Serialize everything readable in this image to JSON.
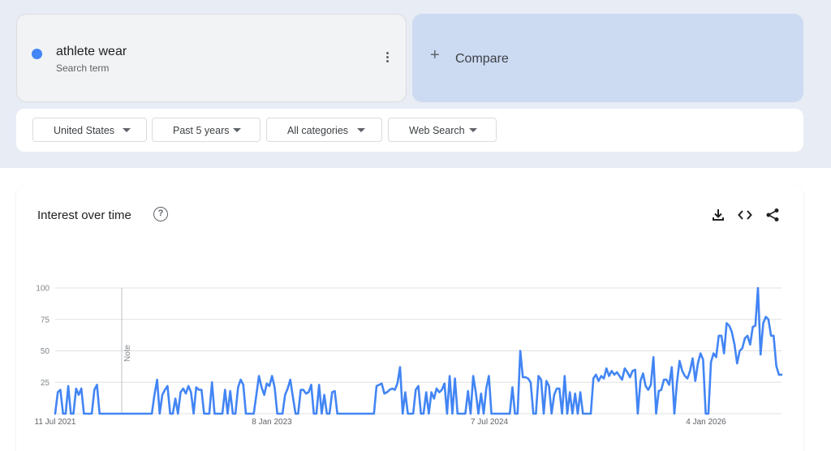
{
  "search_term": {
    "name": "athlete wear",
    "subtitle": "Search term",
    "color": "#4285f4"
  },
  "compare": {
    "plus": "+",
    "label": "Compare"
  },
  "filters": [
    {
      "label": "United States"
    },
    {
      "label": "Past 5 years"
    },
    {
      "label": "All categories"
    },
    {
      "label": "Web Search"
    }
  ],
  "chart_panel": {
    "title": "Interest over time",
    "help_icon": "?",
    "actions": [
      "download-icon",
      "embed-code-icon",
      "share-icon"
    ]
  },
  "chart_data": {
    "type": "line",
    "title": "Interest over time",
    "series": [
      {
        "name": "athlete wear",
        "color": "#4285f4",
        "values": [
          0,
          17,
          19,
          0,
          0,
          22,
          0,
          0,
          20,
          15,
          20,
          0,
          0,
          0,
          0,
          19,
          23,
          0,
          0,
          0,
          0,
          0,
          0,
          0,
          0,
          0,
          0,
          0,
          0,
          0,
          0,
          0,
          0,
          0,
          0,
          0,
          0,
          0,
          15,
          27,
          0,
          15,
          19,
          22,
          0,
          0,
          12,
          0,
          17,
          20,
          16,
          22,
          17,
          0,
          21,
          19,
          19,
          0,
          0,
          0,
          25,
          0,
          0,
          0,
          0,
          19,
          0,
          18,
          0,
          0,
          21,
          27,
          23,
          0,
          0,
          0,
          0,
          15,
          30,
          21,
          15,
          24,
          22,
          30,
          21,
          0,
          0,
          0,
          15,
          20,
          27,
          13,
          0,
          0,
          19,
          19,
          16,
          17,
          23,
          0,
          0,
          23,
          0,
          15,
          0,
          0,
          17,
          18,
          0,
          0,
          0,
          0,
          0,
          0,
          0,
          0,
          0,
          0,
          0,
          0,
          0,
          0,
          0,
          22,
          23,
          24,
          16,
          17,
          19,
          20,
          19,
          24,
          37,
          0,
          17,
          0,
          0,
          0,
          19,
          22,
          0,
          0,
          17,
          0,
          17,
          12,
          20,
          17,
          19,
          24,
          0,
          30,
          0,
          28,
          0,
          0,
          0,
          0,
          18,
          0,
          30,
          17,
          0,
          16,
          0,
          20,
          30,
          0,
          0,
          0,
          0,
          0,
          0,
          0,
          0,
          21,
          0,
          0,
          50,
          29,
          29,
          28,
          25,
          0,
          0,
          30,
          27,
          0,
          26,
          22,
          0,
          15,
          20,
          20,
          0,
          30,
          0,
          17,
          0,
          16,
          0,
          17,
          0,
          0,
          0,
          0,
          28,
          31,
          26,
          30,
          28,
          36,
          30,
          34,
          31,
          33,
          30,
          27,
          36,
          33,
          29,
          34,
          35,
          0,
          26,
          32,
          22,
          19,
          23,
          45,
          0,
          18,
          19,
          27,
          27,
          23,
          37,
          0,
          25,
          42,
          34,
          30,
          28,
          34,
          44,
          26,
          40,
          48,
          43,
          0,
          0,
          41,
          48,
          45,
          62,
          62,
          48,
          72,
          70,
          65,
          55,
          40,
          50,
          52,
          60,
          62,
          55,
          69,
          70,
          100,
          47,
          72,
          77,
          75,
          62,
          62,
          38,
          31,
          31
        ]
      }
    ],
    "x_tick_labels": [
      "11 Jul 2021",
      "8 Jan 2023",
      "7 Jul 2024",
      "4 Jan 2026"
    ],
    "y_ticks": [
      25,
      50,
      75,
      100
    ],
    "ylim": [
      0,
      100
    ],
    "grid": true,
    "annotation": "Note"
  }
}
